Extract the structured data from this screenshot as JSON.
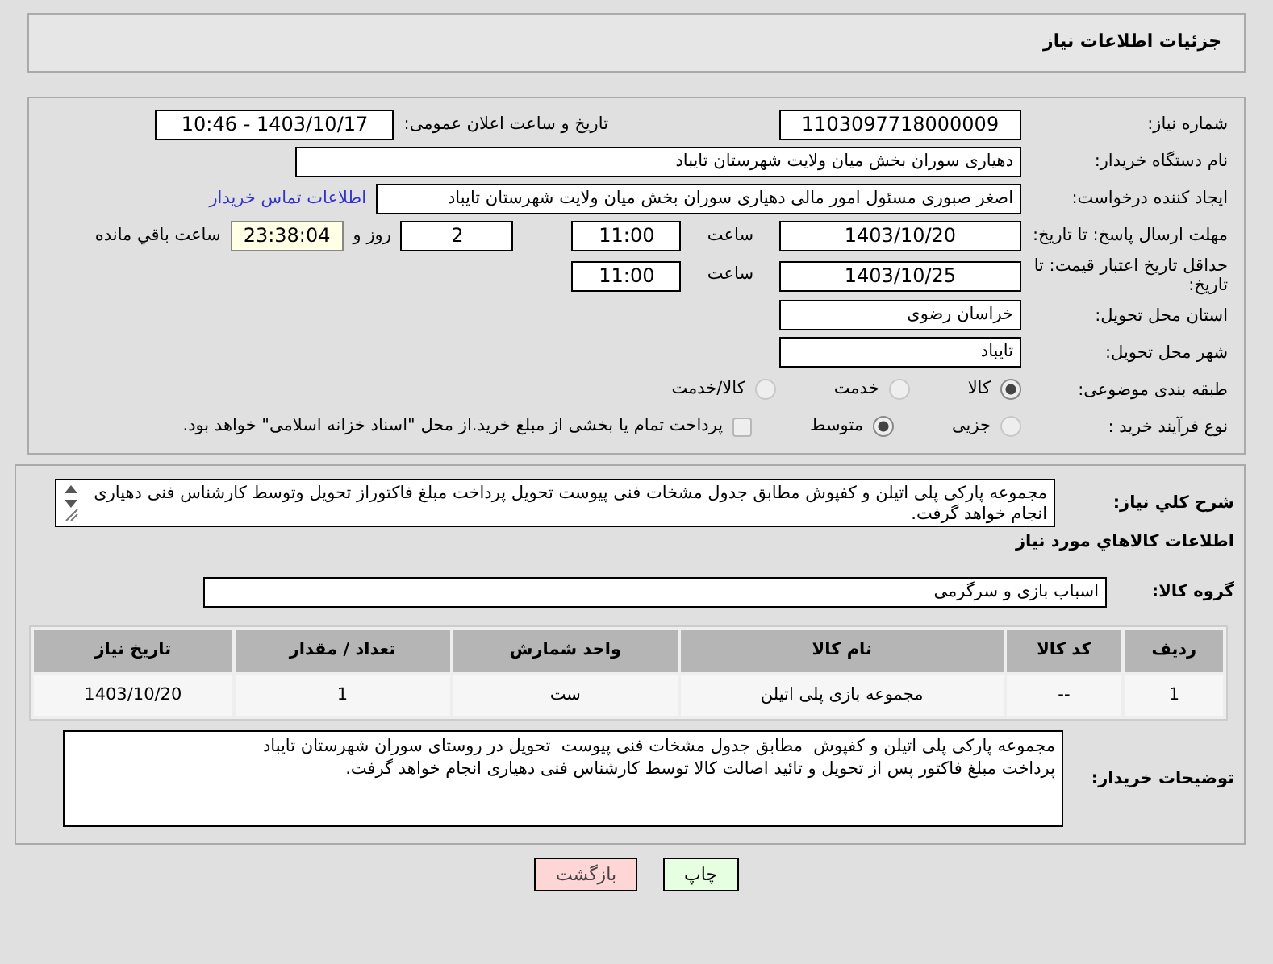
{
  "page_title": "جزئیات اطلاعات نیاز",
  "need_number": {
    "label": "شماره نیاز:",
    "value": "1103097718000009"
  },
  "announcement": {
    "label": "تاریخ و ساعت اعلان عمومی:",
    "value": "1403/10/17 - 10:46"
  },
  "buyer": {
    "label": "نام دستگاه خریدار:",
    "value": "دهیاری سوران بخش میان ولایت شهرستان تایباد"
  },
  "requester": {
    "label": "ایجاد کننده درخواست:",
    "value": "اصغر صبوری مسئول امور مالی دهیاری سوران بخش میان ولایت شهرستان تایباد",
    "link": "اطلاعات تماس خریدار"
  },
  "reply_deadline": {
    "label": "مهلت ارسال پاسخ: تا تاریخ:",
    "date": "1403/10/20",
    "time_label": "ساعت",
    "time": "11:00",
    "days": "2",
    "days_label": "روز و",
    "remaining": "23:38:04",
    "remaining_label": "ساعت باقي مانده"
  },
  "price_validity": {
    "label": "حداقل تاریخ اعتبار قیمت: تا تاریخ:",
    "date": "1403/10/25",
    "time_label": "ساعت",
    "time": "11:00"
  },
  "province": {
    "label": "استان محل تحویل:",
    "value": "خراسان رضوی"
  },
  "city": {
    "label": "شهر محل تحویل:",
    "value": "تایباد"
  },
  "category": {
    "label": "طبقه بندی موضوعی:",
    "options": [
      {
        "label": "کالا",
        "selected": true
      },
      {
        "label": "خدمت",
        "selected": false
      },
      {
        "label": "کالا/خدمت",
        "selected": false
      }
    ]
  },
  "purchase_type": {
    "label": "نوع فرآیند خرید :",
    "options": [
      {
        "label": "جزیی",
        "selected": false
      },
      {
        "label": "متوسط",
        "selected": true
      }
    ],
    "payment": {
      "label": "پرداخت تمام یا بخشی از مبلغ خرید.از محل \"اسناد خزانه اسلامی\" خواهد بود.",
      "checked": false
    }
  },
  "description": {
    "label": "شرح کلي نياز:",
    "value": "مجموعه پارکی پلی اتیلن و کفپوش  مطابق جدول مشخات فنی پیوست  تحویل پرداخت مبلغ فاکتوراز تحویل وتوسط کارشناس فنی دهیاری انجام خواهد گرفت."
  },
  "goods_title": "اطلاعات کالاهاي مورد نياز",
  "goods_group": {
    "label": "گروه کالا:",
    "value": "اسباب بازی و سرگرمی"
  },
  "table": {
    "columns": [
      "ردیف",
      "کد کالا",
      "نام کالا",
      "واحد شمارش",
      "تعداد / مقدار",
      "تاریخ نیاز"
    ],
    "rows": [
      [
        "1",
        "--",
        "مجموعه بازی پلی اتیلن",
        "ست",
        "1",
        "1403/10/20"
      ]
    ]
  },
  "buyer_notes": {
    "label": "توضیحات خریدار:",
    "value": "مجموعه پارکی پلی اتیلن و کفپوش  مطابق جدول مشخات فنی پیوست  تحویل در روستای سوران شهرستان تایباد\nپرداخت مبلغ فاکتور پس از تحویل و تائید اصالت کالا توسط کارشناس فنی دهیاری انجام خواهد گرفت."
  },
  "buttons": [
    {
      "label": "چاپ",
      "kind": "print"
    },
    {
      "label": "بازگشت",
      "kind": "back"
    }
  ]
}
